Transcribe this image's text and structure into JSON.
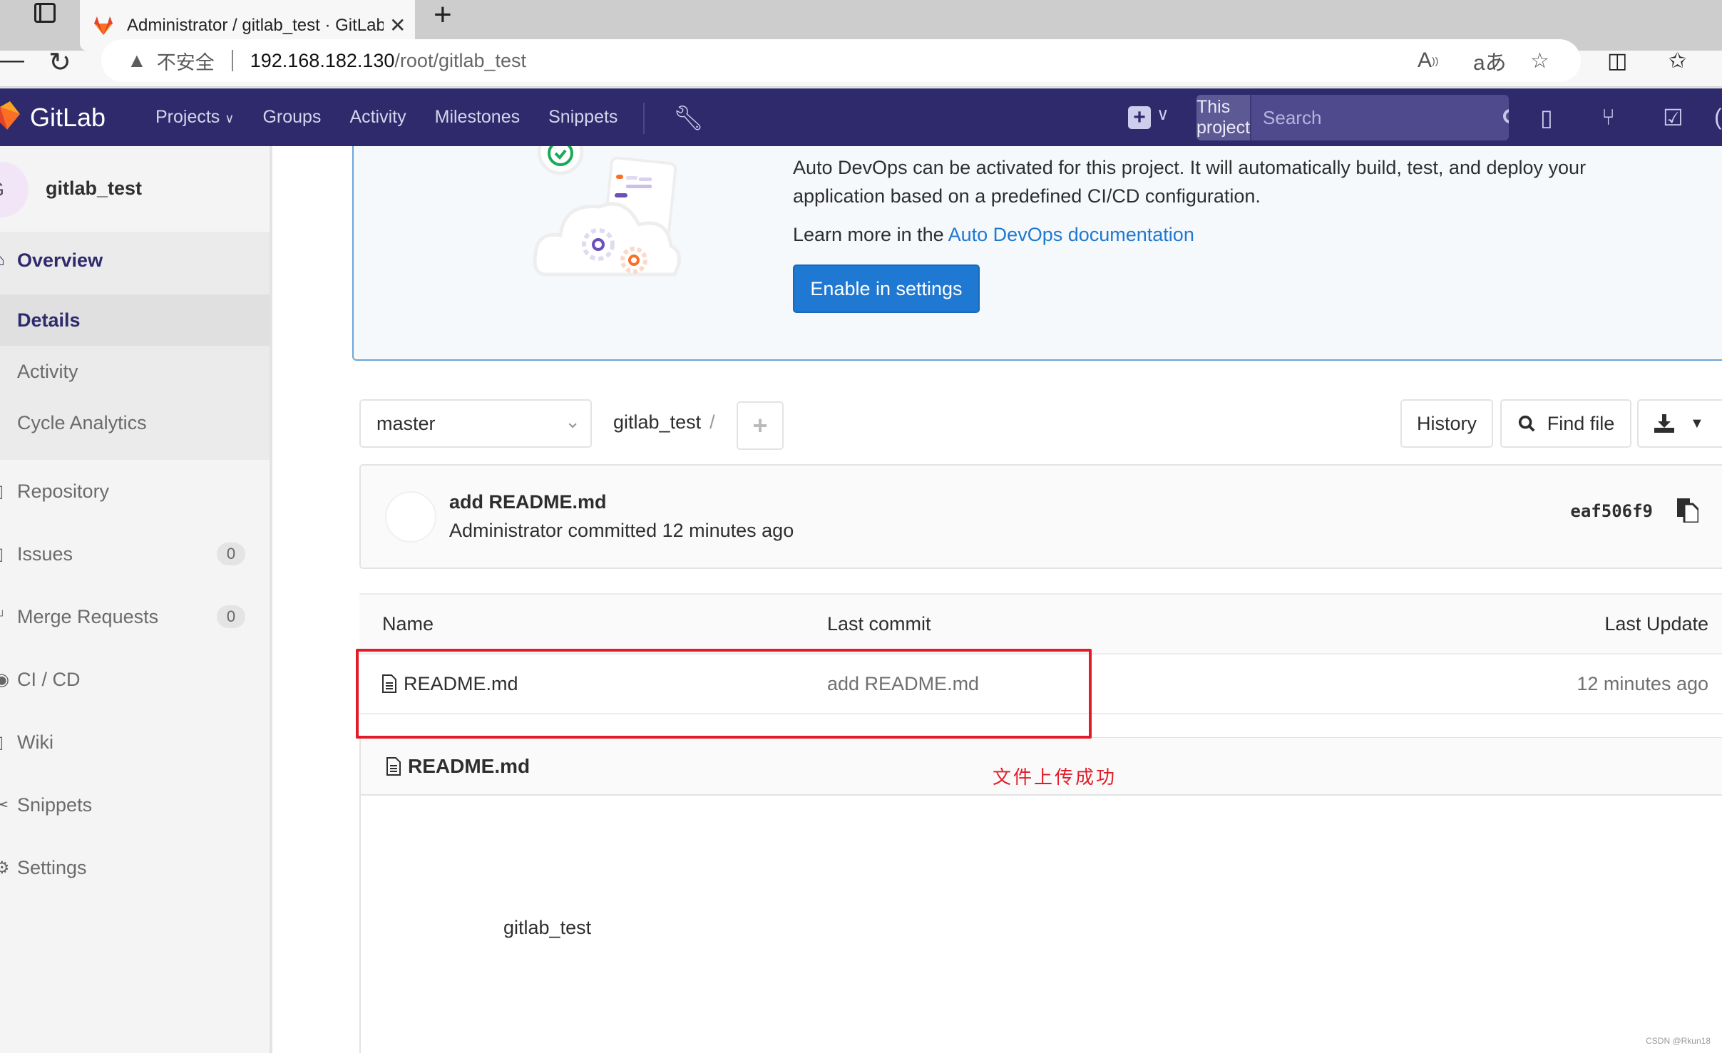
{
  "browser": {
    "tab_title": "Administrator / gitlab_test · GitLab",
    "address": {
      "security_label": "不安全",
      "url_host": "192.168.182.130",
      "url_path": "/root/gitlab_test"
    }
  },
  "navbar": {
    "brand": "GitLab",
    "links": [
      "Projects",
      "Groups",
      "Activity",
      "Milestones",
      "Snippets"
    ],
    "search_scope": "This project",
    "search_placeholder": "Search"
  },
  "sidebar": {
    "avatar_letter": "G",
    "project_name": "gitlab_test",
    "overview": {
      "label": "Overview",
      "subitems": [
        "Details",
        "Activity",
        "Cycle Analytics"
      ]
    },
    "items": [
      {
        "label": "Repository"
      },
      {
        "label": "Issues",
        "count": "0"
      },
      {
        "label": "Merge Requests",
        "count": "0"
      },
      {
        "label": "CI / CD"
      },
      {
        "label": "Wiki"
      },
      {
        "label": "Snippets"
      },
      {
        "label": "Settings"
      }
    ]
  },
  "banner": {
    "text": "Auto DevOps can be activated for this project. It will automatically build, test, and deploy your application based on a predefined CI/CD configuration.",
    "learn_prefix": "Learn more in the ",
    "learn_link": "Auto DevOps documentation",
    "button": "Enable in settings"
  },
  "toolbar": {
    "branch": "master",
    "breadcrumb": "gitlab_test",
    "breadcrumb_sep": "/",
    "history": "History",
    "find_file": "Find file"
  },
  "commit": {
    "title": "add README.md",
    "meta": "Administrator committed 12 minutes ago",
    "sha": "eaf506f9"
  },
  "tree": {
    "headers": {
      "name": "Name",
      "last_commit": "Last commit",
      "last_update": "Last Update"
    },
    "rows": [
      {
        "name": "README.md",
        "last_commit": "add README.md",
        "last_update": "12 minutes ago"
      }
    ]
  },
  "readme": {
    "filename": "README.md",
    "content": "gitlab_test"
  },
  "annotation": {
    "text": "文件上传成功",
    "color": "#e21b28"
  },
  "watermark": "CSDN @Rkun18",
  "colors": {
    "navbar": "#2f2a6b",
    "primary_button": "#1f78d1",
    "annotation_red": "#e21b28"
  }
}
